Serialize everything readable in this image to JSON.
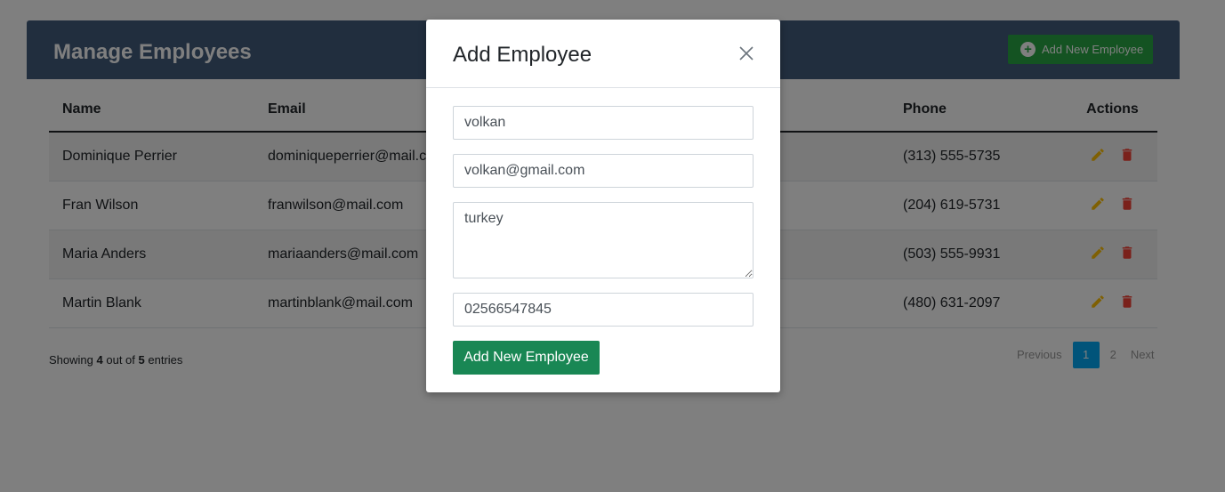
{
  "header": {
    "title": "Manage Employees",
    "add_button_label": "Add New Employee"
  },
  "table": {
    "columns": [
      "Name",
      "Email",
      "Phone",
      "Actions"
    ],
    "rows": [
      {
        "name": "Dominique Perrier",
        "email": "dominiqueperrier@mail.com",
        "phone": "(313) 555-5735"
      },
      {
        "name": "Fran Wilson",
        "email": "franwilson@mail.com",
        "phone": "(204) 619-5731"
      },
      {
        "name": "Maria Anders",
        "email": "mariaanders@mail.com",
        "phone": "(503) 555-9931"
      },
      {
        "name": "Martin Blank",
        "email": "martinblank@mail.com",
        "phone": "(480) 631-2097"
      }
    ]
  },
  "footer": {
    "showing_prefix": "Showing",
    "shown_count": "4",
    "out_of": "out of",
    "total_count": "5",
    "entries": "entries"
  },
  "pagination": {
    "previous": "Previous",
    "pages": [
      "1",
      "2"
    ],
    "active_page": "1",
    "next": "Next"
  },
  "modal": {
    "title": "Add Employee",
    "name_value": "volkan",
    "email_value": "volkan@gmail.com",
    "address_value": "turkey",
    "phone_value": "02566547845",
    "submit_label": "Add New Employee"
  },
  "colors": {
    "header_bg": "#435d7d",
    "success_green": "#198754",
    "edit_yellow": "#ffc107",
    "delete_red": "#f44336",
    "active_page_blue": "#03a9f4"
  },
  "icons": {
    "add": "plus-circle-icon",
    "edit": "pencil-icon",
    "delete": "trash-icon",
    "close": "close-icon"
  }
}
